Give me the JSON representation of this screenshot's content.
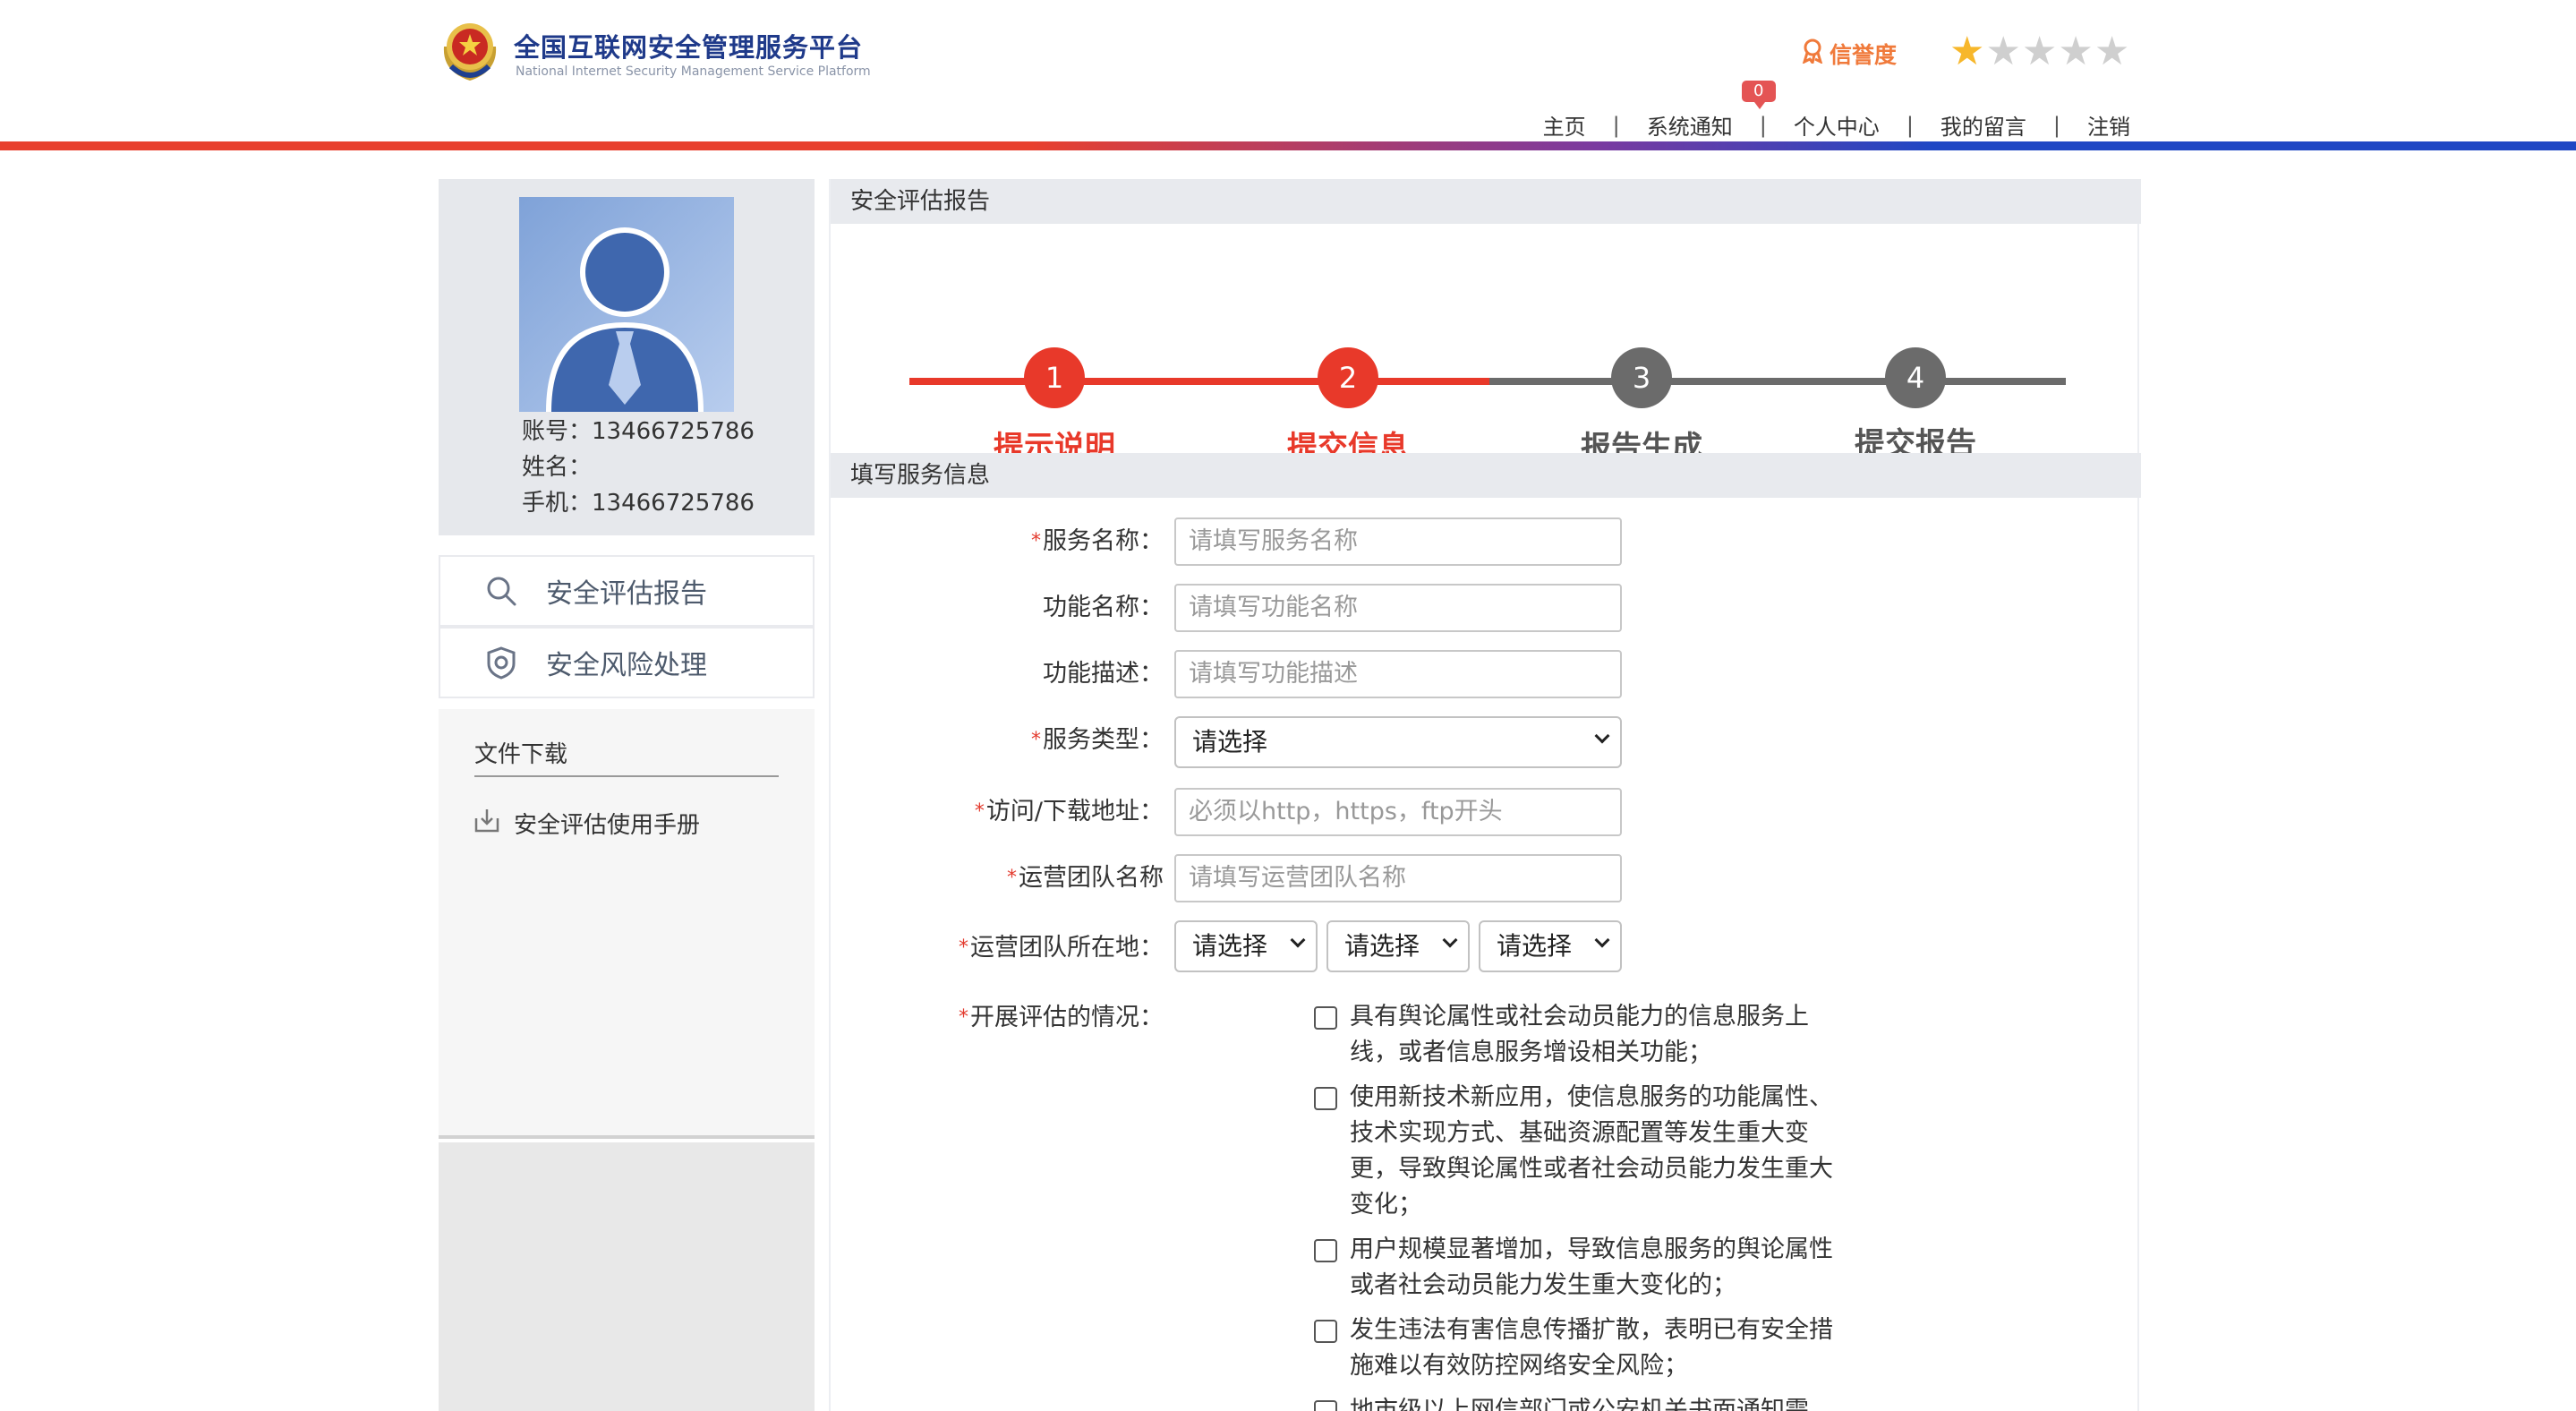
{
  "header": {
    "title": "全国互联网安全管理服务平台",
    "subtitle": "National Internet Security Management Service Platform",
    "credit_label": "信誉度",
    "stars_filled": 1,
    "stars_total": 5,
    "nav": {
      "home": "主页",
      "notice": "系统通知",
      "notice_badge": "0",
      "personal": "个人中心",
      "messages": "我的留言",
      "logout": "注销"
    }
  },
  "sidebar": {
    "account": "账号：13466725786",
    "name": "姓名：",
    "phone": "手机：13466725786",
    "menu": {
      "report": "安全评估报告",
      "risk": "安全风险处理"
    },
    "downloads": {
      "title": "文件下载",
      "item": "安全评估使用手册"
    }
  },
  "main": {
    "page_title": "安全评估报告",
    "steps": [
      {
        "num": "1",
        "label": "提示说明"
      },
      {
        "num": "2",
        "label": "提交信息"
      },
      {
        "num": "3",
        "label": "报告生成"
      },
      {
        "num": "4",
        "label": "提交报告"
      }
    ],
    "section_title": "填写服务信息",
    "form": {
      "service_name": {
        "label": "服务名称：",
        "placeholder": "请填写服务名称"
      },
      "function_name": {
        "label": "功能名称：",
        "placeholder": "请填写功能名称"
      },
      "function_desc": {
        "label": "功能描述：",
        "placeholder": "请填写功能描述"
      },
      "service_type": {
        "label": "服务类型：",
        "value": "请选择"
      },
      "url": {
        "label": "访问/下载地址：",
        "placeholder": "必须以http，https，ftp开头"
      },
      "team_name": {
        "label": "运营团队名称",
        "placeholder": "请填写运营团队名称"
      },
      "team_location": {
        "label": "运营团队所在地：",
        "province": "请选择",
        "city": "请选择",
        "district": "请选择"
      },
      "situation": {
        "label": "开展评估的情况：",
        "options": [
          "具有舆论属性或社会动员能力的信息服务上线，或者信息服务增设相关功能；",
          "使用新技术新应用，使信息服务的功能属性、技术实现方式、基础资源配置等发生重大变更，导致舆论属性或者社会动员能力发生重大变化；",
          "用户规模显著增加，导致信息服务的舆论属性或者社会动员能力发生重大变化的；",
          "发生违法有害信息传播扩散，表明已有安全措施难以有效防控网络安全风险；",
          "地市级以上网信部门或公安机关书面通知需"
        ]
      }
    }
  },
  "colors": {
    "accent_red": "#e8392a",
    "brand_blue": "#1f3a8a",
    "inactive_gray": "#666666",
    "star": "#f7b72b",
    "credit_orange": "#f07a3b"
  }
}
